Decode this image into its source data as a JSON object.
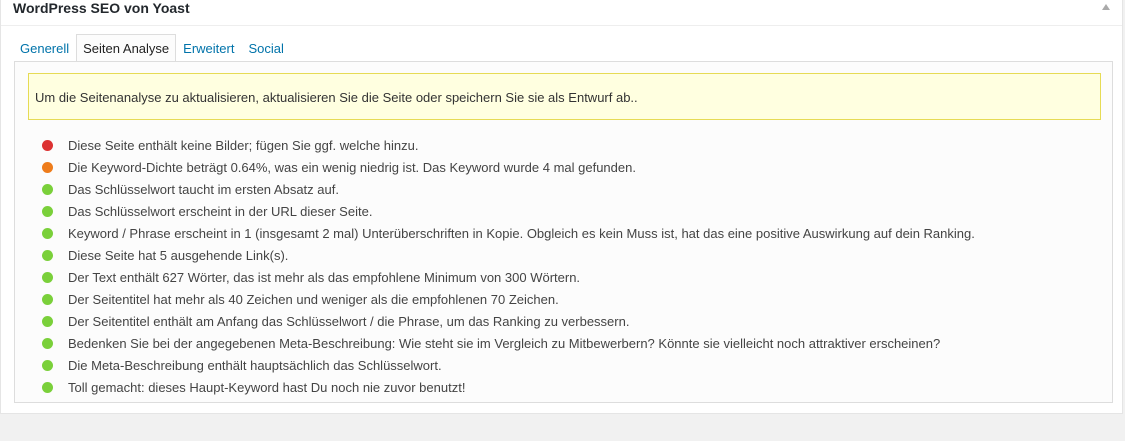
{
  "metabox": {
    "title": "WordPress SEO von Yoast"
  },
  "tabs": [
    {
      "label": "Generell",
      "active": false
    },
    {
      "label": "Seiten Analyse",
      "active": true
    },
    {
      "label": "Erweitert",
      "active": false
    },
    {
      "label": "Social",
      "active": false
    }
  ],
  "notice": {
    "text": "Um die Seitenanalyse zu aktualisieren, aktualisieren Sie die Seite oder speichern Sie sie als Entwurf ab.."
  },
  "colors": {
    "bad": "#dc3232",
    "ok": "#ee7c1b",
    "good": "#7ad03a",
    "link": "#0073aa",
    "notice_bg": "#ffffe0",
    "notice_border": "#e6db55"
  },
  "results": [
    {
      "status": "bad",
      "text": "Diese Seite enthält keine Bilder; fügen Sie ggf. welche hinzu."
    },
    {
      "status": "ok",
      "text": "Die Keyword-Dichte beträgt 0.64%, was ein wenig niedrig ist. Das Keyword wurde 4 mal gefunden."
    },
    {
      "status": "good",
      "text": "Das Schlüsselwort taucht im ersten Absatz auf."
    },
    {
      "status": "good",
      "text": "Das Schlüsselwort erscheint in der URL dieser Seite."
    },
    {
      "status": "good",
      "text": "Keyword / Phrase erscheint in 1 (insgesamt 2 mal) Unterüberschriften in Kopie. Obgleich es kein Muss ist, hat das eine positive Auswirkung auf dein Ranking."
    },
    {
      "status": "good",
      "text": "Diese Seite hat 5 ausgehende Link(s)."
    },
    {
      "status": "good",
      "text": "Der Text enthält 627 Wörter, das ist mehr als das empfohlene Minimum von 300 Wörtern."
    },
    {
      "status": "good",
      "text": "Der Seitentitel hat mehr als 40 Zeichen und weniger als die empfohlenen 70 Zeichen."
    },
    {
      "status": "good",
      "text": "Der Seitentitel enthält am Anfang das Schlüsselwort / die Phrase, um das Ranking zu verbessern."
    },
    {
      "status": "good",
      "text": "Bedenken Sie bei der angegebenen Meta-Beschreibung: Wie steht sie im Vergleich zu Mitbewerbern? Könnte sie vielleicht noch attraktiver erscheinen?"
    },
    {
      "status": "good",
      "text": "Die Meta-Beschreibung enthält hauptsächlich das Schlüsselwort."
    },
    {
      "status": "good",
      "text": "Toll gemacht: dieses Haupt-Keyword hast Du noch nie zuvor benutzt!"
    }
  ]
}
